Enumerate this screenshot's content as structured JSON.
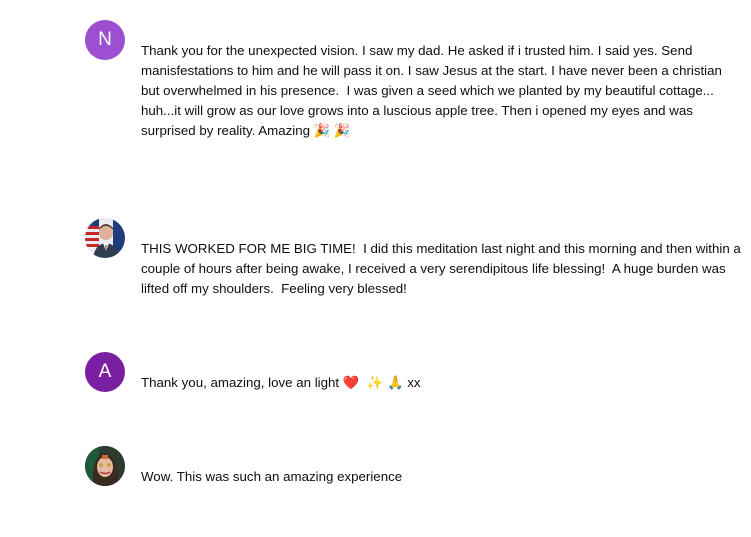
{
  "comments": [
    {
      "avatar_letter": "N",
      "avatar_color": "#9c4fd0",
      "text": "Thank you for the unexpected vision. I saw my dad. He asked if i trusted him. I said yes. Send manisfestations to him and he will pass it on. I saw Jesus at the start. I have never been a christian but overwhelmed in his presence.  I was given a seed which we planted by my beautiful cottage... huh...it will grow as our love grows into a luscious apple tree. Then i opened my eyes and was surprised by reality. Amazing 🎉 🎉"
    },
    {
      "avatar_image": "photo-avatar-man-flag",
      "text": "THIS WORKED FOR ME BIG TIME!  I did this meditation last night and this morning and then within a couple of hours after being awake, I received a very serendipitous life blessing!  A huge burden was lifted off my shoulders.  Feeling very blessed!"
    },
    {
      "avatar_letter": "A",
      "avatar_color": "#7b1fa2",
      "text": "Thank you, amazing, love an light ❤️  ✨ 🙏 xx"
    },
    {
      "avatar_image": "photo-avatar-woman",
      "text": "Wow. This was such an amazing experience"
    }
  ]
}
